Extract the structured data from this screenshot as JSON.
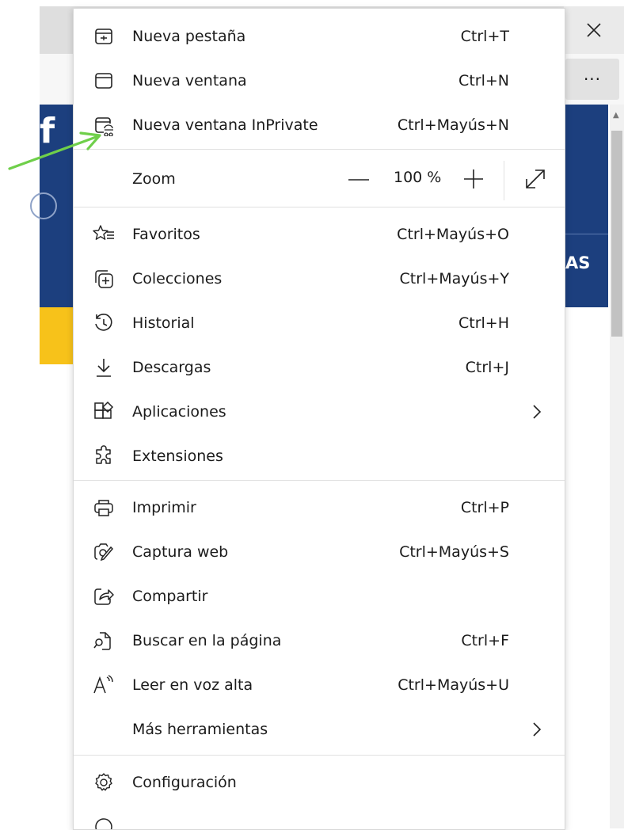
{
  "browser": {
    "close_glyph": "✕",
    "more_glyph": "···",
    "page_partial_text": "AS",
    "page_logo_partial": "f"
  },
  "menu": {
    "items_top": [
      {
        "label": "Nueva pestaña",
        "shortcut": "Ctrl+T",
        "icon": "new-tab-icon"
      },
      {
        "label": "Nueva ventana",
        "shortcut": "Ctrl+N",
        "icon": "new-window-icon"
      },
      {
        "label": "Nueva ventana InPrivate",
        "shortcut": "Ctrl+Mayús+N",
        "icon": "inprivate-window-icon"
      }
    ],
    "zoom": {
      "label": "Zoom",
      "value": "100 %",
      "minus_icon": "zoom-out-icon",
      "plus_icon": "zoom-in-icon",
      "fullscreen_icon": "fullscreen-icon"
    },
    "items_mid": [
      {
        "label": "Favoritos",
        "shortcut": "Ctrl+Mayús+O",
        "icon": "favorites-icon"
      },
      {
        "label": "Colecciones",
        "shortcut": "Ctrl+Mayús+Y",
        "icon": "collections-icon"
      },
      {
        "label": "Historial",
        "shortcut": "Ctrl+H",
        "icon": "history-icon"
      },
      {
        "label": "Descargas",
        "shortcut": "Ctrl+J",
        "icon": "downloads-icon"
      },
      {
        "label": "Aplicaciones",
        "shortcut": "",
        "icon": "apps-icon",
        "submenu": true
      },
      {
        "label": "Extensiones",
        "shortcut": "",
        "icon": "extensions-icon"
      }
    ],
    "items_tools": [
      {
        "label": "Imprimir",
        "shortcut": "Ctrl+P",
        "icon": "print-icon"
      },
      {
        "label": "Captura web",
        "shortcut": "Ctrl+Mayús+S",
        "icon": "web-capture-icon"
      },
      {
        "label": "Compartir",
        "shortcut": "",
        "icon": "share-icon"
      },
      {
        "label": "Buscar en la página",
        "shortcut": "Ctrl+F",
        "icon": "find-on-page-icon"
      },
      {
        "label": "Leer en voz alta",
        "shortcut": "Ctrl+Mayús+U",
        "icon": "read-aloud-icon"
      },
      {
        "label": "Más herramientas",
        "shortcut": "",
        "icon": "",
        "submenu": true
      }
    ],
    "items_bottom": [
      {
        "label": "Configuración",
        "shortcut": "",
        "icon": "settings-icon"
      }
    ]
  },
  "colors": {
    "annotation_arrow": "#6fcf4a",
    "page_header_blue": "#1c3f7e",
    "page_banner_yellow": "#f7c21a"
  }
}
